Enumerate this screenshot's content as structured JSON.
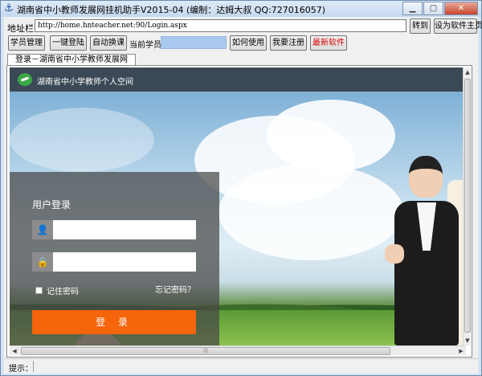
{
  "window": {
    "title": "湖南省中小教师发展网挂机助手V2015-04 (编制：达姆大叔 QQ:727016057)",
    "icon": "anchor-icon",
    "controls": [
      "minimize",
      "maximize",
      "close"
    ]
  },
  "addressbar": {
    "label": "地址栏:",
    "url": "http://home.hnteacher.net:90/Login.aspx",
    "goto_label": "转到",
    "set_home_label": "设为软件主页"
  },
  "toolbar": {
    "student_manage": "学员管理",
    "one_click_login": "一键登陆",
    "auto_switch": "自动换课",
    "current_student_label": "当前学员：",
    "current_student_value": "",
    "how_to_use": "如何使用",
    "register": "我要注册",
    "latest_software": "最新软件",
    "latest_color": "#d00000"
  },
  "tab": {
    "label": "登录－湖南省中小学教师发展网"
  },
  "site": {
    "header_title": "湖南省中小学教师个人空间",
    "login_title": "用户登录",
    "username_placeholder": "",
    "password_placeholder": "",
    "remember_label": "记住密码",
    "forgot_label": "忘记密码？",
    "login_button": "登 录",
    "accent_color": "#f4650c"
  },
  "statusbar": {
    "label": "提示："
  }
}
